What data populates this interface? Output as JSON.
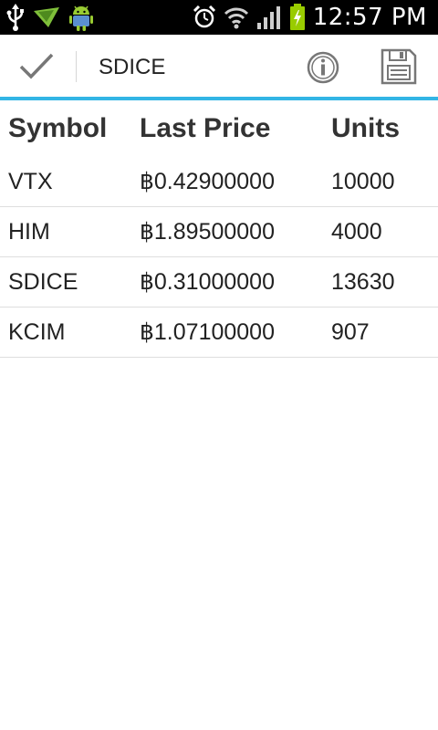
{
  "status_bar": {
    "time": "12:57 PM",
    "icons": [
      "usb-icon",
      "download-notification-icon",
      "android-icon",
      "alarm-icon",
      "wifi-icon",
      "signal-icon",
      "battery-charging-icon"
    ]
  },
  "action_bar": {
    "title": "SDICE",
    "icons": [
      "checkmark-icon",
      "info-icon",
      "save-icon"
    ]
  },
  "table": {
    "headers": [
      "Symbol",
      "Last Price",
      "Units"
    ],
    "rows": [
      {
        "symbol": "VTX",
        "price": "฿0.42900000",
        "units": "10000"
      },
      {
        "symbol": "HIM",
        "price": "฿1.89500000",
        "units": "4000"
      },
      {
        "symbol": "SDICE",
        "price": "฿0.31000000",
        "units": "13630"
      },
      {
        "symbol": "KCIM",
        "price": "฿1.07100000",
        "units": "907"
      }
    ]
  },
  "colors": {
    "accent": "#33b5e5",
    "status_bar_bg": "#000000",
    "battery": "#99cc00"
  }
}
